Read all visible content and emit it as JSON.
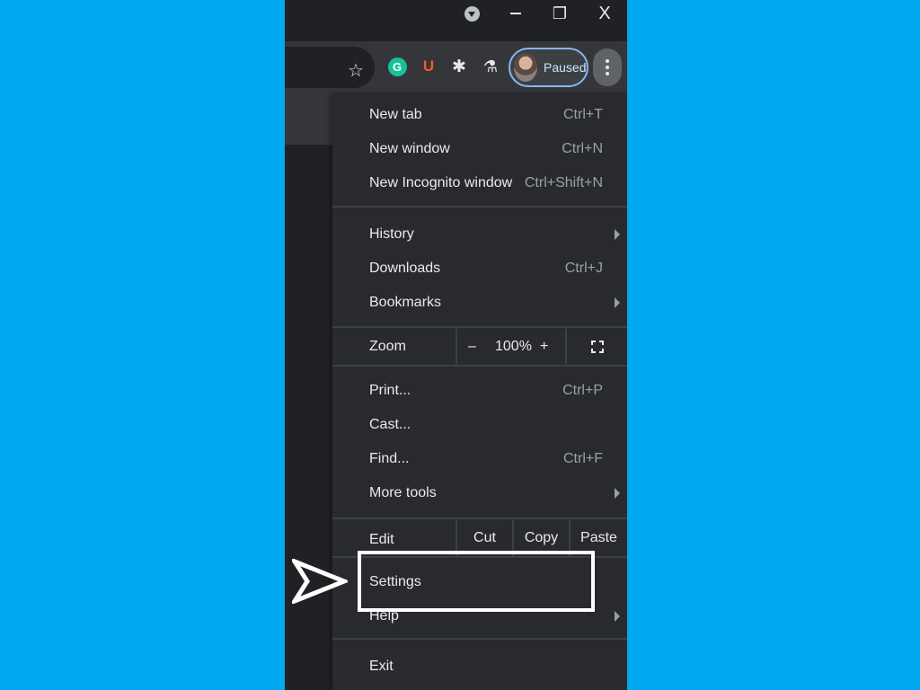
{
  "titlebar": {
    "minimize": "–",
    "restore": "❐",
    "close": "X"
  },
  "toolbar": {
    "star_icon": "☆",
    "extensions": {
      "grammarly": "G",
      "ublock": "U",
      "puzzle_icon": "✱",
      "lab_icon": "⚗"
    },
    "profile_status": "Paused"
  },
  "menu": {
    "new_tab": {
      "label": "New tab",
      "shortcut": "Ctrl+T"
    },
    "new_window": {
      "label": "New window",
      "shortcut": "Ctrl+N"
    },
    "new_incognito": {
      "label": "New Incognito window",
      "shortcut": "Ctrl+Shift+N"
    },
    "history": {
      "label": "History"
    },
    "downloads": {
      "label": "Downloads",
      "shortcut": "Ctrl+J"
    },
    "bookmarks": {
      "label": "Bookmarks"
    },
    "zoom": {
      "label": "Zoom",
      "minus": "–",
      "level": "100%",
      "plus": "+"
    },
    "print": {
      "label": "Print...",
      "shortcut": "Ctrl+P"
    },
    "cast": {
      "label": "Cast..."
    },
    "find": {
      "label": "Find...",
      "shortcut": "Ctrl+F"
    },
    "more_tools": {
      "label": "More tools"
    },
    "edit": {
      "label": "Edit",
      "cut": "Cut",
      "copy": "Copy",
      "paste": "Paste"
    },
    "settings": {
      "label": "Settings"
    },
    "help": {
      "label": "Help"
    },
    "exit": {
      "label": "Exit"
    }
  },
  "colors": {
    "background": "#00A8F0",
    "menu_bg": "#292A2D",
    "highlight": "#ffffff"
  }
}
